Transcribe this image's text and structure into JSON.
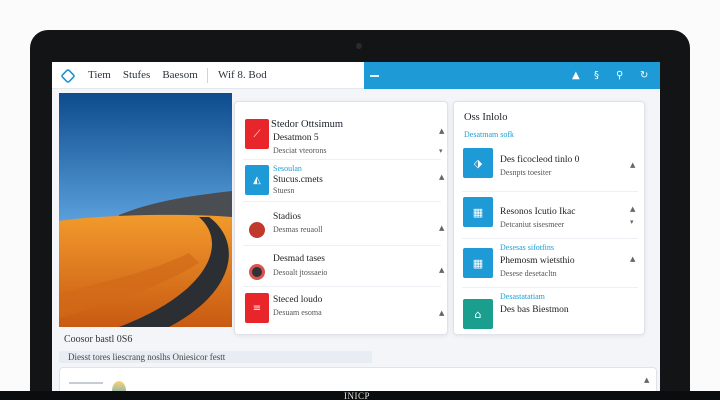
{
  "topbar": {
    "nav": [
      "Tiem",
      "Stufes",
      "Baesom"
    ],
    "right_label": "Wif 8. Bod",
    "strip_icons": [
      "up-icon",
      "s-icon",
      "search-icon",
      "refresh-icon"
    ]
  },
  "left_card": {
    "title": "Stedor Ottsimum",
    "rows": [
      {
        "line1": "Desatmon 5",
        "line2": "Desciat vteorons",
        "color": "#e8252a",
        "icon": "pdf-icon"
      },
      {
        "accent": "Sesoulan",
        "line1": "Stucus.cmets",
        "line2": "Stuesn",
        "color": "#1e9ad6",
        "icon": "stack-icon"
      },
      {
        "line1": "Stadios",
        "line2": "Desmas reuaoll",
        "color": "#c0392b",
        "icon": "record-icon"
      },
      {
        "line1": "Desmad tases",
        "line2": "Desoalt jtossaeio",
        "color": "#2f3338",
        "icon": "record-icon"
      },
      {
        "line1": "Steced loudo",
        "line2": "Desuam esoma",
        "color": "#e8252a",
        "icon": "list-icon"
      }
    ]
  },
  "right_card": {
    "title": "Oss Inlolo",
    "accent": "Desatmam sofk",
    "rows": [
      {
        "line1": "Des ficocleod tinlo 0",
        "line2": "Desnpts toesiter",
        "color": "#1e9ad6",
        "icon": "tag-icon"
      },
      {
        "line1": "Resonos Icutio Ikac",
        "line2": "Detcaniut sisesmeer",
        "color": "#1e9ad6",
        "icon": "grid-icon"
      },
      {
        "accent": "Desesas sifotfins",
        "line1": "Phemosm wietsthio",
        "line2": "Desese desetacltn",
        "color": "#1e9ad6",
        "icon": "grid-icon"
      },
      {
        "accent": "Desastatatiam",
        "line1": "Des bas Biestmon",
        "line2": "",
        "color": "#1a9e8e",
        "icon": "folder-icon"
      }
    ]
  },
  "bottom": {
    "label": "Coosor bastl 0S6",
    "bar_text": "Diesst tores liescrang noslhs Oniesicor festt"
  },
  "base_label": "INICP",
  "colors": {
    "accent_blue": "#1e9ad6",
    "accent_red": "#e8252a",
    "accent_teal": "#1a9e8e"
  }
}
